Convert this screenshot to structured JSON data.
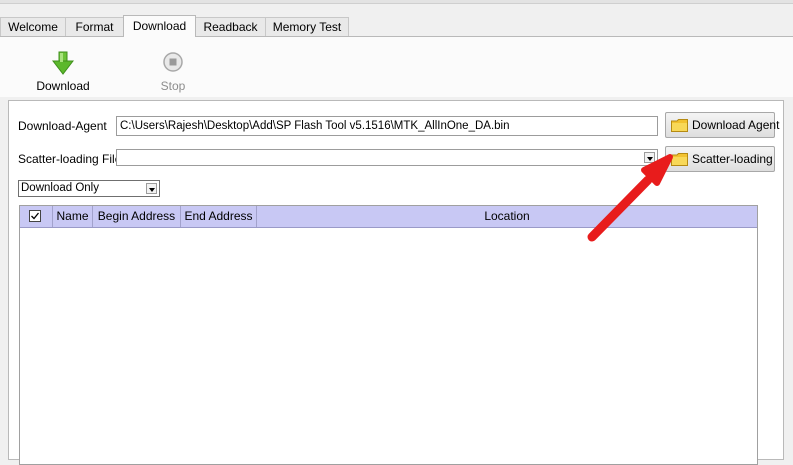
{
  "tabs": [
    {
      "label": "Welcome",
      "active": false
    },
    {
      "label": "Format",
      "active": false
    },
    {
      "label": "Download",
      "active": true
    },
    {
      "label": "Readback",
      "active": false
    },
    {
      "label": "Memory Test",
      "active": false
    }
  ],
  "toolbar": {
    "download_label": "Download",
    "stop_label": "Stop"
  },
  "form": {
    "download_agent_label": "Download-Agent",
    "download_agent_value": "C:\\Users\\Rajesh\\Desktop\\Add\\SP Flash Tool v5.1516\\MTK_AllInOne_DA.bin",
    "download_agent_button": "Download Agent",
    "scatter_label": "Scatter-loading File",
    "scatter_value": "",
    "scatter_button": "Scatter-loading",
    "mode_selected": "Download Only"
  },
  "table": {
    "columns": [
      "Name",
      "Begin Address",
      "End Address",
      "Location"
    ],
    "rows": []
  },
  "colors": {
    "header_bg": "#c8c8f4",
    "annotation_arrow": "#e81c1c",
    "download_icon": "#5cb82c"
  }
}
